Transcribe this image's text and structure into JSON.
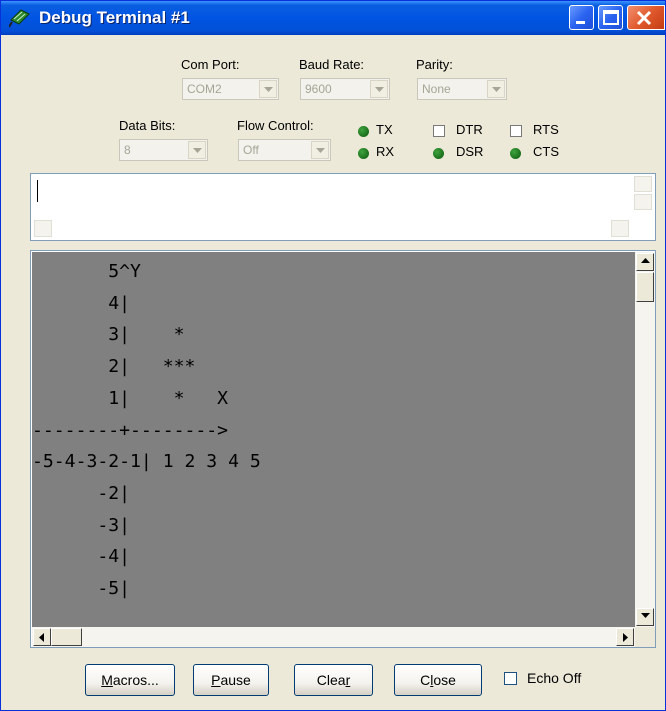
{
  "window": {
    "title": "Debug Terminal #1"
  },
  "settings": {
    "com_port": {
      "label": "Com Port:",
      "value": "COM2"
    },
    "baud_rate": {
      "label": "Baud Rate:",
      "value": "9600"
    },
    "parity": {
      "label": "Parity:",
      "value": "None"
    },
    "data_bits": {
      "label": "Data Bits:",
      "value": "8"
    },
    "flow_control": {
      "label": "Flow Control:",
      "value": "Off"
    }
  },
  "indicators": {
    "tx": "TX",
    "rx": "RX",
    "dtr": "DTR",
    "rts": "RTS",
    "dsr": "DSR",
    "cts": "CTS"
  },
  "receive": {
    "lines": [
      "       5^Y",
      "       4|",
      "       3|    *",
      "       2|   ***",
      "       1|    *   X",
      "--------+-------->",
      "-5-4-3-2-1| 1 2 3 4 5",
      "      -2|",
      "      -3|",
      "      -4|",
      "      -5|"
    ]
  },
  "buttons": {
    "macros": {
      "accel": "M",
      "rest": "acros..."
    },
    "pause": {
      "accel": "P",
      "rest": "ause"
    },
    "clear": {
      "pre": "Clea",
      "accel": "r"
    },
    "close": {
      "pre": "C",
      "accel": "l",
      "rest": "ose"
    },
    "echo_off": "Echo Off"
  },
  "colors": {
    "title_bar": "#0054e3",
    "window_bg": "#ece9d8",
    "receive_bg": "#808080",
    "led": "#1e7a1e"
  }
}
